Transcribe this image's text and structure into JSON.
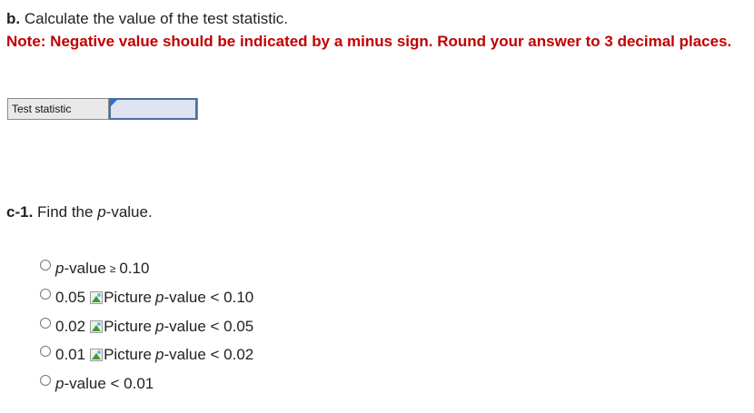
{
  "part_b": {
    "label": "b.",
    "text": "Calculate the value of the test statistic."
  },
  "note": "Note: Negative value should be indicated by a minus sign. Round your answer to 3 decimal places.",
  "answer_table": {
    "label": "Test statistic",
    "value": ""
  },
  "part_c1": {
    "label": "c-1.",
    "text_before": "Find the ",
    "text_ital": "p",
    "text_after": "-value."
  },
  "options": [
    {
      "parts": [
        "p",
        "-value",
        "≥",
        "0.10"
      ]
    },
    {
      "parts": [
        "0.05",
        "Picture",
        "p",
        "-value < 0.10"
      ]
    },
    {
      "parts": [
        "0.02",
        "Picture",
        "p",
        "-value < 0.05"
      ]
    },
    {
      "parts": [
        "0.01",
        "Picture",
        "p",
        "-value < 0.02"
      ]
    },
    {
      "parts": [
        "p",
        "-value < 0.01"
      ]
    }
  ]
}
